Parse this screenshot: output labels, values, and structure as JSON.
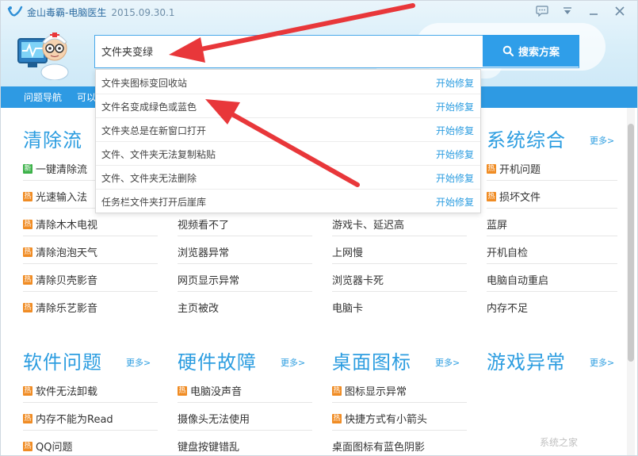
{
  "window": {
    "title": "金山毒霸-电脑医生",
    "version": "2015.09.30.1"
  },
  "search": {
    "value": "文件夹变绿",
    "button_label": "搜索方案"
  },
  "navbar": {
    "label": "问题导航",
    "text": "可以"
  },
  "dropdown": [
    {
      "text": "文件夹图标变回收站",
      "action": "开始修复"
    },
    {
      "text": "文件名变成绿色或蓝色",
      "action": "开始修复"
    },
    {
      "text": "文件夹总是在新窗口打开",
      "action": "开始修复"
    },
    {
      "text": "文件、文件夹无法复制粘贴",
      "action": "开始修复"
    },
    {
      "text": "文件、文件夹无法删除",
      "action": "开始修复"
    },
    {
      "text": "任务栏文件夹打开后崖库",
      "action": "开始修复"
    }
  ],
  "sections_top": [
    {
      "title": "清除流",
      "more": "",
      "items": [
        {
          "tag": "新",
          "text": "一键清除流"
        },
        {
          "tag": "热",
          "text": "光速输入法"
        },
        {
          "tag": "热",
          "text": "清除木木电视"
        },
        {
          "tag": "热",
          "text": "清除泡泡天气"
        },
        {
          "tag": "热",
          "text": "清除贝壳影音"
        },
        {
          "tag": "热",
          "text": "清除乐艺影音"
        }
      ]
    },
    {
      "title": "",
      "more": "",
      "items": [
        {
          "tag": "",
          "text": ""
        },
        {
          "tag": "",
          "text": ""
        },
        {
          "tag": "",
          "text": "视频看不了"
        },
        {
          "tag": "",
          "text": "浏览器异常"
        },
        {
          "tag": "",
          "text": "网页显示异常"
        },
        {
          "tag": "",
          "text": "主页被改"
        }
      ]
    },
    {
      "title": "",
      "more": "",
      "items": [
        {
          "tag": "",
          "text": ""
        },
        {
          "tag": "",
          "text": ""
        },
        {
          "tag": "",
          "text": "游戏卡、延迟高"
        },
        {
          "tag": "",
          "text": "上网慢"
        },
        {
          "tag": "",
          "text": "浏览器卡死"
        },
        {
          "tag": "",
          "text": "电脑卡"
        }
      ]
    },
    {
      "title": "系统综合",
      "more": "更多>",
      "items": [
        {
          "tag": "热",
          "text": "开机问题"
        },
        {
          "tag": "热",
          "text": "损坏文件"
        },
        {
          "tag": "",
          "text": "蓝屏"
        },
        {
          "tag": "",
          "text": "开机自检"
        },
        {
          "tag": "",
          "text": "电脑自动重启"
        },
        {
          "tag": "",
          "text": "内存不足"
        }
      ]
    }
  ],
  "sections_bottom": [
    {
      "title": "软件问题",
      "more": "更多>",
      "items": [
        {
          "tag": "热",
          "text": "软件无法卸载"
        },
        {
          "tag": "热",
          "text": "内存不能为Read"
        },
        {
          "tag": "热",
          "text": "QQ问题"
        }
      ]
    },
    {
      "title": "硬件故障",
      "more": "更多>",
      "items": [
        {
          "tag": "热",
          "text": "电脑没声音"
        },
        {
          "tag": "",
          "text": "摄像头无法使用"
        },
        {
          "tag": "",
          "text": "键盘按键错乱"
        }
      ]
    },
    {
      "title": "桌面图标",
      "more": "更多>",
      "items": [
        {
          "tag": "热",
          "text": "图标显示异常"
        },
        {
          "tag": "热",
          "text": "快捷方式有小箭头"
        },
        {
          "tag": "",
          "text": "桌面图标有蓝色阴影"
        }
      ]
    },
    {
      "title": "游戏异常",
      "more": "更多>",
      "items": []
    }
  ],
  "watermark": "系统之家",
  "colors": {
    "accent": "#2c9de0",
    "hot_tag": "#f08c24",
    "new_tag": "#3db24a",
    "arrow": "#e8373a"
  }
}
